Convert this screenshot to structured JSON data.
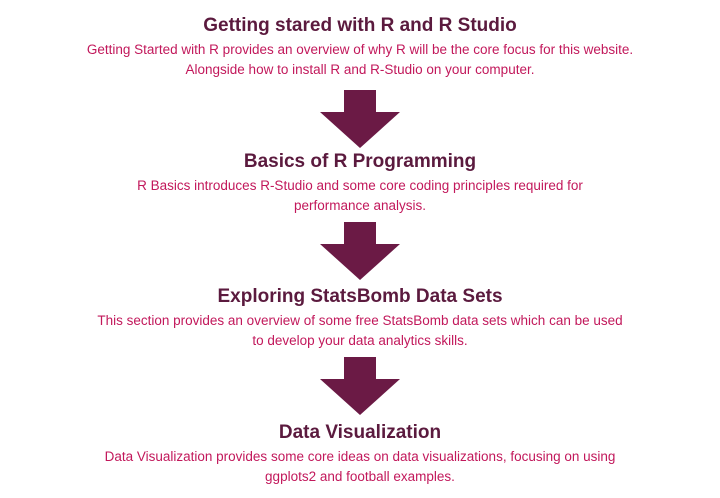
{
  "steps": [
    {
      "title": "Getting stared with R and R Studio",
      "description": "Getting Started with R provides an overview of why R will be the core focus for this website. Alongside how to install R and R-Studio on your computer."
    },
    {
      "title": "Basics of R Programming",
      "description": "R Basics introduces R-Studio and some core coding principles required for performance analysis."
    },
    {
      "title": "Exploring StatsBomb Data Sets",
      "description": "This section provides an overview of some free StatsBomb data sets which can be used to develop your data analytics skills."
    },
    {
      "title": "Data Visualization",
      "description": "Data Visualization provides some core ideas on data visualizations, focusing on using ggplots2 and football examples."
    }
  ],
  "colors": {
    "title": "#5b1a3e",
    "description": "#c2185b",
    "arrow": "#6b1a45"
  },
  "arrow_icon": "down-arrow-icon"
}
